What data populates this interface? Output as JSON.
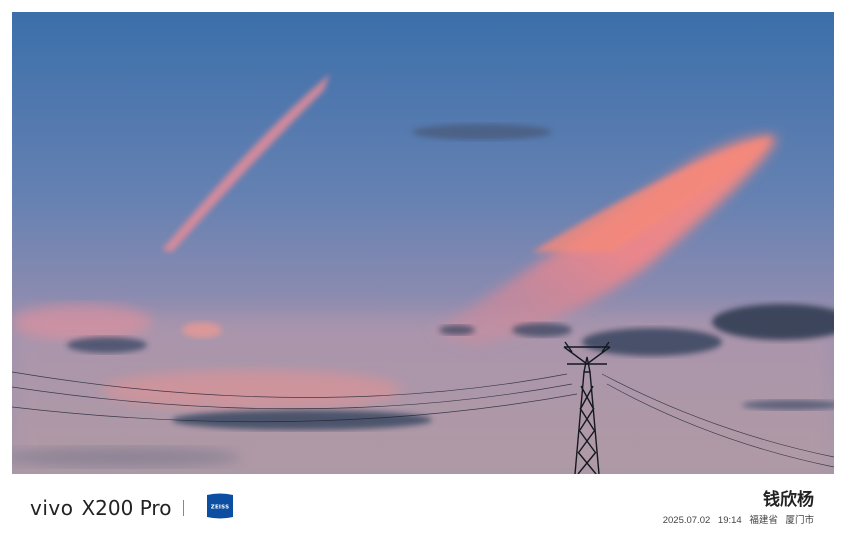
{
  "watermark": {
    "brand": "vivo",
    "model": "X200 Pro",
    "lens_partner_logo": "ZEISS",
    "photographer": "钱欣杨",
    "date": "2025.07.02",
    "time": "19:14",
    "province": "福建省",
    "city": "厦门市"
  },
  "photo": {
    "subject": "sunset-sky-with-power-pylon",
    "colors": {
      "sky_top": "#3f74ad",
      "sky_bottom": "#a89aae",
      "pink_cloud": "#f08a8a",
      "dark_cloud": "#3a4660"
    }
  },
  "colors": {
    "zeiss_blue": "#0b4ea2",
    "text_dark": "#222222"
  }
}
